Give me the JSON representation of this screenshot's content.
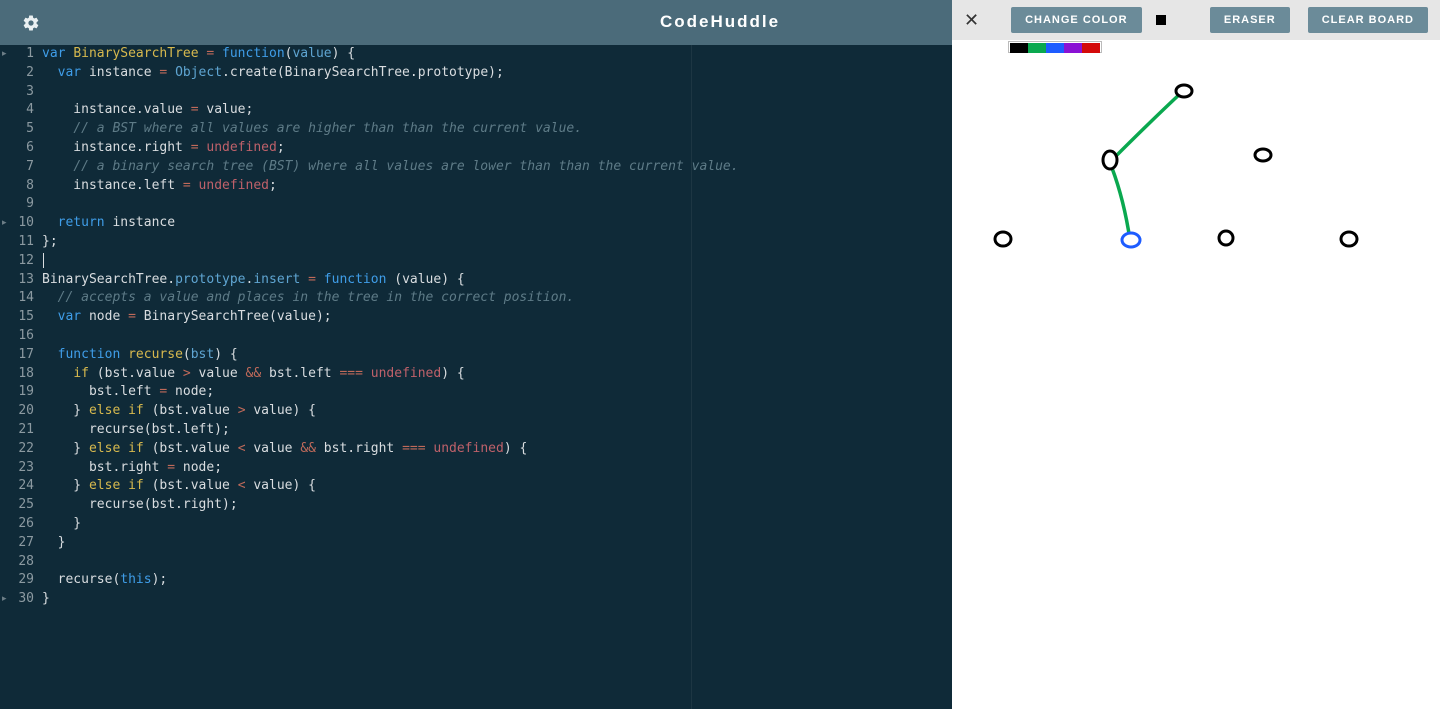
{
  "header": {
    "title": "CodeHuddle"
  },
  "draw": {
    "change_color": "CHANGE COLOR",
    "eraser": "ERASER",
    "clear_board": "CLEAR BOARD",
    "palette": [
      "#000000",
      "#0aa84f",
      "#1e5cff",
      "#8a12d4",
      "#d40a0a"
    ]
  },
  "editor": {
    "line_count": 30,
    "lines": [
      "var <def>BinarySearchTree</def> <op>=</op> <kw>function</kw>(<id>value</id>) {",
      "  <kw>var</kw> instance <op>=</op> <id>Object</id>.create(BinarySearchTree.prototype);",
      "",
      "    instance.value <op>=</op> value;",
      "    <cm>// a BST where all values are higher than than the current value.</cm>",
      "    instance.right <op>=</op> <lit>undefined</lit>;",
      "    <cm>// a binary search tree (BST) where all values are lower than than the current value.</cm>",
      "    instance.left <op>=</op> <lit>undefined</lit>;",
      "",
      "  <kw>return</kw> instance",
      "};",
      "",
      "BinarySearchTree.<id>prototype</id>.<id>insert</id> <op>=</op> <kw>function</kw> (value) {",
      "  <cm>// accepts a value and places in the tree in the correct position.</cm>",
      "  <kw>var</kw> node <op>=</op> BinarySearchTree(value);",
      "",
      "  <kw>function</kw> <def>recurse</def>(<id>bst</id>) {",
      "    <kw2>if</kw2> (bst.value <op>&gt;</op> value <op>&amp;&amp;</op> bst.left <op>===</op> <lit>undefined</lit>) {",
      "      bst.left <op>=</op> node;",
      "    } <kw2>else</kw2> <kw2>if</kw2> (bst.value <op>&gt;</op> value) {",
      "      recurse(bst.left);",
      "    } <kw2>else</kw2> <kw2>if</kw2> (bst.value <op>&lt;</op> value <op>&amp;&amp;</op> bst.right <op>===</op> <lit>undefined</lit>) {",
      "      bst.right <op>=</op> node;",
      "    } <kw2>else</kw2> <kw2>if</kw2> (bst.value <op>&lt;</op> value) {",
      "      recurse(bst.right);",
      "    }",
      "  }",
      "",
      "  recurse(<kw>this</kw>);",
      "}"
    ]
  }
}
